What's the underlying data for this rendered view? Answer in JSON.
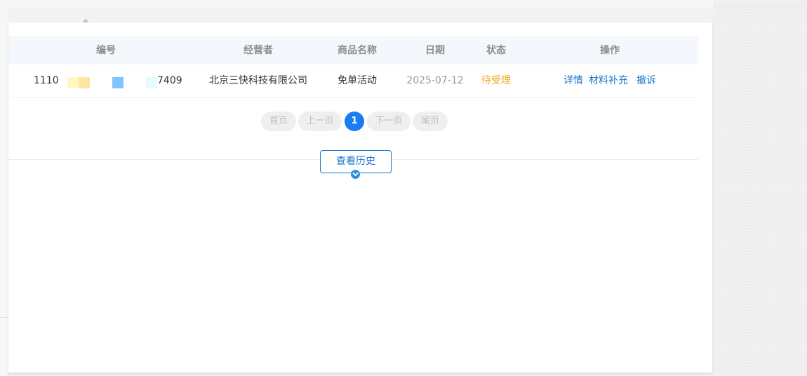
{
  "table": {
    "headers": {
      "number": "编号",
      "operator": "经营者",
      "product": "商品名称",
      "date": "日期",
      "status": "状态",
      "actions": "操作"
    },
    "rows": [
      {
        "number_prefix": "1110",
        "number_suffix": "7409",
        "operator": "北京三快科技有限公司",
        "product": "免单活动",
        "date": "2025-07-12",
        "status": "待受理",
        "actions": {
          "detail": "详情",
          "supplement": "材料补充",
          "withdraw": "撤诉"
        }
      }
    ]
  },
  "pager": {
    "first": "首页",
    "prev": "上一页",
    "current": "1",
    "next": "下一页",
    "last": "尾页"
  },
  "history": {
    "label": "查看历史"
  },
  "colors": {
    "link": "#1677c9",
    "status_pending": "#f5a623",
    "page_active": "#1a7cf4",
    "header_bg": "#f4f7fb"
  },
  "icons": {
    "expand": "chevron-down-icon"
  }
}
